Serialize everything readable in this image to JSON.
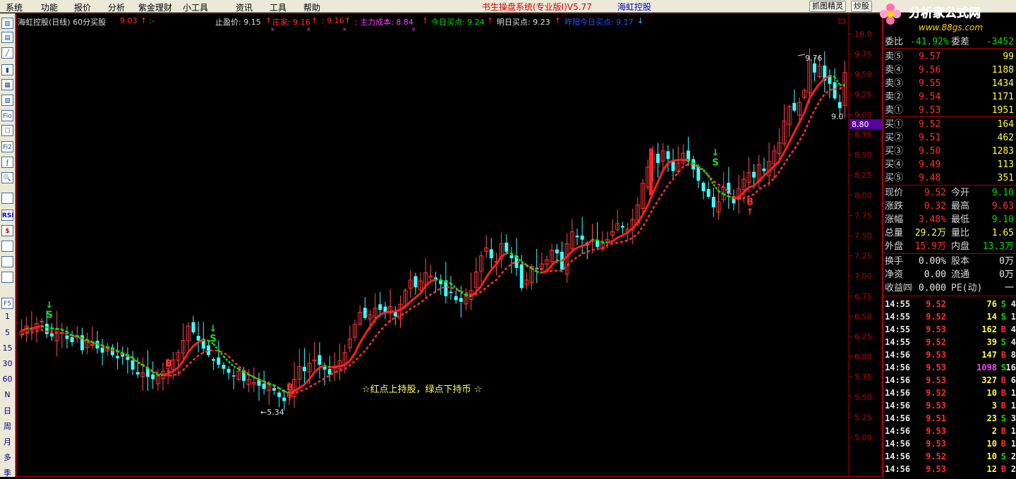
{
  "menu": [
    "系统",
    "功能",
    "报价",
    "分析",
    "紫金理财",
    "小工具",
    "资讯",
    "工具",
    "帮助"
  ],
  "app_title": "书生操盘系统(专业版I)V5.77",
  "stock_title": "海虹控股",
  "title_buttons": [
    "抓图精灵",
    "炒股"
  ],
  "logo": {
    "text": "分析家公式网",
    "url": "www.88gs.com"
  },
  "toolbar_items": [
    "",
    "",
    "",
    "",
    "",
    "",
    "Fio",
    "",
    "Fi2",
    "",
    "",
    "",
    "RSI",
    "$",
    "",
    "",
    "",
    "",
    "F5",
    "1",
    "5",
    "15",
    "30",
    "60",
    "N",
    "日",
    "周",
    "月",
    "多",
    "季"
  ],
  "info": {
    "name": "海虹控股(日线) 60分买股",
    "price": "9.03",
    "stop_label": "止盈价: 9.15",
    "banker_label": "庄家: 9.16",
    "banker2": ": 9.16",
    "cost_label": ": 主力成本: 8.84",
    "today_buy": "今日买点: 9.24",
    "tomorrow_buy": "明日买点: 9.23",
    "tip_label": "昨阳今日买点: 9.17"
  },
  "annotation_text": "☆红点上持股，绿点下持币 ☆",
  "high_label": "9.76",
  "low_label": "5.34",
  "last_label": "9.0",
  "current_marker": "8.80",
  "signals": [
    "S",
    "B",
    "S",
    "B",
    "S",
    "B"
  ],
  "chart_data": {
    "type": "candlestick",
    "y_ticks": [
      "10.0",
      "9.75",
      "9.50",
      "9.25",
      "9.00",
      "8.75",
      "8.50",
      "8.25",
      "8.00",
      "7.75",
      "7.50",
      "7.25",
      "7.00",
      "6.75",
      "6.50",
      "6.25",
      "6.00",
      "5.75",
      "5.50",
      "5.25",
      "5.00"
    ],
    "ylim": [
      4.9,
      10.1
    ],
    "closes": [
      6.32,
      6.38,
      6.35,
      6.41,
      6.44,
      6.28,
      6.25,
      6.34,
      6.3,
      6.22,
      6.18,
      6.26,
      6.08,
      6.2,
      6.15,
      6.1,
      6.05,
      6.12,
      6.02,
      5.98,
      6.0,
      5.96,
      5.84,
      5.78,
      5.8,
      5.75,
      5.72,
      5.76,
      5.82,
      5.9,
      5.96,
      6.05,
      6.2,
      6.38,
      6.3,
      6.2,
      6.1,
      6.02,
      5.95,
      5.9,
      5.85,
      5.8,
      5.76,
      5.82,
      5.7,
      5.72,
      5.68,
      5.64,
      5.6,
      5.66,
      5.58,
      5.5,
      5.45,
      5.55,
      5.72,
      5.88,
      5.82,
      5.92,
      5.96,
      5.9,
      5.84,
      5.78,
      5.86,
      5.95,
      6.05,
      6.22,
      6.4,
      6.55,
      6.48,
      6.52,
      6.6,
      6.58,
      6.55,
      6.62,
      6.5,
      6.65,
      6.82,
      6.95,
      6.86,
      6.94,
      7.04,
      7.0,
      6.95,
      6.9,
      6.75,
      6.8,
      6.7,
      6.68,
      6.75,
      6.82,
      7.05,
      7.25,
      7.35,
      7.22,
      7.18,
      7.4,
      7.3,
      7.22,
      7.1,
      6.85,
      6.95,
      7.12,
      7.08,
      7.15,
      7.2,
      7.32,
      7.28,
      7.08,
      7.4,
      7.55,
      7.48,
      7.45,
      7.38,
      7.44,
      7.36,
      7.4,
      7.45,
      7.55,
      7.65,
      7.6,
      7.58,
      7.7,
      7.88,
      8.15,
      8.35,
      8.52,
      8.4,
      8.55,
      8.45,
      8.3,
      8.4,
      8.52,
      8.42,
      8.32,
      8.18,
      8.05,
      7.98,
      7.85,
      7.92,
      8.1,
      8.02,
      7.9,
      8.08,
      8.2,
      8.28,
      8.22,
      8.38,
      8.3,
      8.42,
      8.55,
      8.65,
      8.92,
      9.1,
      9.05,
      9.15,
      9.3,
      9.68,
      9.52,
      9.6,
      9.42,
      9.38,
      9.2,
      9.08,
      9.52
    ],
    "series": [
      {
        "name": "庄家"
      },
      {
        "name": "主力成本"
      }
    ]
  },
  "quote": {
    "header": {
      "l1": "委比",
      "v1": "-41.92%",
      "l2": "委差",
      "v2": "-3452"
    },
    "sells": [
      {
        "label": "卖⑤",
        "price": "9.57",
        "vol": "99"
      },
      {
        "label": "卖④",
        "price": "9.56",
        "vol": "1188"
      },
      {
        "label": "卖③",
        "price": "9.55",
        "vol": "1434"
      },
      {
        "label": "卖②",
        "price": "9.54",
        "vol": "1171"
      },
      {
        "label": "卖①",
        "price": "9.53",
        "vol": "1951"
      }
    ],
    "buys": [
      {
        "label": "买①",
        "price": "9.52",
        "vol": "164"
      },
      {
        "label": "买②",
        "price": "9.51",
        "vol": "462"
      },
      {
        "label": "买③",
        "price": "9.50",
        "vol": "1283"
      },
      {
        "label": "买④",
        "price": "9.49",
        "vol": "113"
      },
      {
        "label": "买⑤",
        "price": "9.48",
        "vol": "351"
      }
    ],
    "stats": [
      {
        "l1": "现价",
        "v1": "9.52",
        "c1": "red",
        "l2": "今开",
        "v2": "9.10",
        "c2": "grn"
      },
      {
        "l1": "涨跌",
        "v1": "0.32",
        "c1": "red",
        "l2": "最高",
        "v2": "9.63",
        "c2": "red"
      },
      {
        "l1": "涨幅",
        "v1": "3.48%",
        "c1": "red",
        "l2": "最低",
        "v2": "9.10",
        "c2": "grn"
      },
      {
        "l1": "总量",
        "v1": "29.2万",
        "c1": "yel",
        "l2": "量比",
        "v2": "1.65",
        "c2": "yel"
      },
      {
        "l1": "外盘",
        "v1": "15.9万",
        "c1": "red",
        "l2": "内盘",
        "v2": "13.3万",
        "c2": "grn"
      }
    ],
    "stats2": [
      {
        "l1": "换手",
        "v1": "0.00%",
        "l2": "股本",
        "v2": "0万"
      },
      {
        "l1": "净资",
        "v1": "0.00",
        "l2": "流通",
        "v2": "0万"
      },
      {
        "l1": "收益㈣",
        "v1": "0.000",
        "l2": "PE(动)",
        "v2": "一"
      }
    ],
    "ticks": [
      {
        "time": "14:55",
        "price": "9.52",
        "vol": "76",
        "side": "S",
        "n": "4"
      },
      {
        "time": "14:55",
        "price": "9.52",
        "vol": "14",
        "side": "S",
        "n": "1"
      },
      {
        "time": "14:55",
        "price": "9.53",
        "vol": "162",
        "side": "B",
        "n": "4"
      },
      {
        "time": "14:55",
        "price": "9.52",
        "vol": "39",
        "side": "S",
        "n": "4"
      },
      {
        "time": "14:56",
        "price": "9.53",
        "vol": "147",
        "side": "B",
        "n": "8"
      },
      {
        "time": "14:56",
        "price": "9.53",
        "vol": "1098",
        "side": "S",
        "n": "16"
      },
      {
        "time": "14:56",
        "price": "9.53",
        "vol": "327",
        "side": "B",
        "n": "6"
      },
      {
        "time": "14:56",
        "price": "9.52",
        "vol": "10",
        "side": "B",
        "n": "1"
      },
      {
        "time": "14:56",
        "price": "9.53",
        "vol": "3",
        "side": "B",
        "n": "1"
      },
      {
        "time": "14:56",
        "price": "9.51",
        "vol": "23",
        "side": "S",
        "n": "3"
      },
      {
        "time": "14:56",
        "price": "9.53",
        "vol": "2",
        "side": "B",
        "n": "1"
      },
      {
        "time": "14:56",
        "price": "9.53",
        "vol": "10",
        "side": "B",
        "n": "1"
      },
      {
        "time": "14:56",
        "price": "9.52",
        "vol": "10",
        "side": "S",
        "n": "2"
      },
      {
        "time": "14:56",
        "price": "9.53",
        "vol": "12",
        "side": "B",
        "n": "2"
      }
    ]
  }
}
